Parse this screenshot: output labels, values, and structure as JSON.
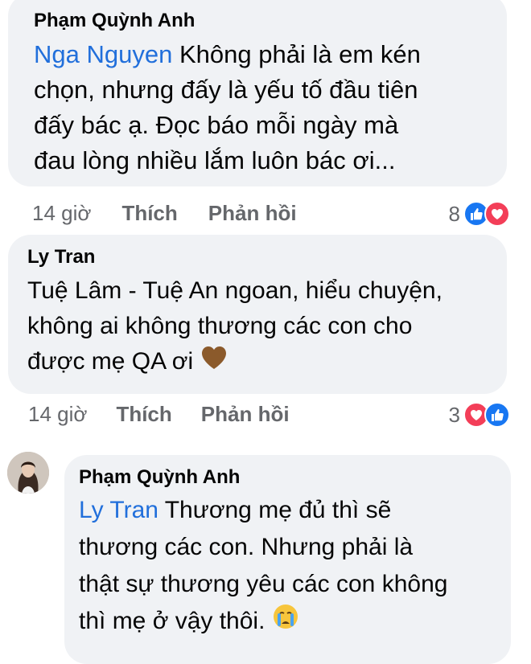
{
  "comment1": {
    "author": "Phạm Quỳnh Anh",
    "mention": "Nga Nguyen",
    "lines": [
      " Không phải là em kén",
      "chọn, nhưng đấy là yếu tố đầu tiên",
      "đấy bác ạ. Đọc báo mỗi ngày mà",
      "đau lòng nhiều lắm luôn bác ơi..."
    ],
    "time": "14 giờ",
    "like_label": "Thích",
    "reply_label": "Phản hồi",
    "reaction_count": "8",
    "reaction_icons": [
      "like-icon",
      "love-icon"
    ]
  },
  "comment2": {
    "author": "Ly Tran",
    "lines": [
      "Tuệ Lâm - Tuệ An ngoan, hiểu chuyện,",
      "không ai không thương các con cho",
      "được mẹ QA ơi"
    ],
    "emoji": "brown-heart-icon",
    "time": "14 giờ",
    "like_label": "Thích",
    "reply_label": "Phản hồi",
    "reaction_count": "3",
    "reaction_icons": [
      "love-icon",
      "like-icon"
    ]
  },
  "comment3": {
    "author": "Phạm Quỳnh Anh",
    "mention": "Ly Tran",
    "lines": [
      " Thương mẹ đủ thì sẽ",
      "thương các con. Nhưng phải là",
      "thật sự thương yêu các con không",
      "thì mẹ ở vậy thôi. "
    ],
    "emoji": "crying-face-icon"
  },
  "colors": {
    "bubble": "#f0f2f5",
    "mention": "#216fdb",
    "meta": "#65676b",
    "like": "#1877f2",
    "love": "#f33e58",
    "brown_heart": "#8b5a2b"
  }
}
